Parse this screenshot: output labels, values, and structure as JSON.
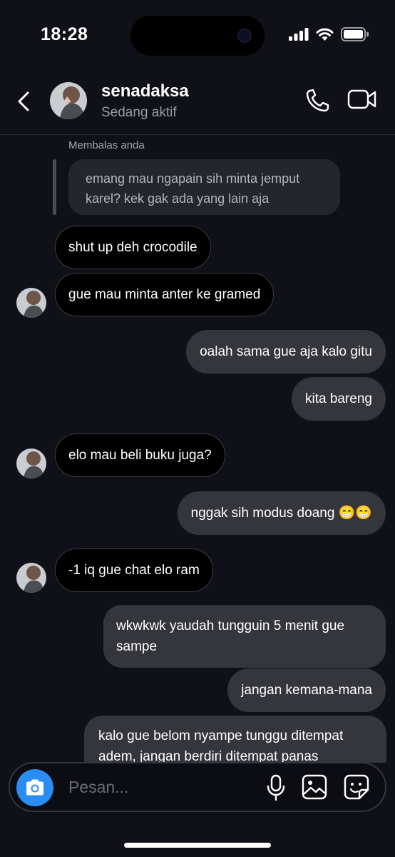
{
  "status": {
    "time": "18:28"
  },
  "header": {
    "name": "senadaksa",
    "subtitle": "Sedang aktif"
  },
  "reply": {
    "label": "Membalas anda",
    "quoted": "emang mau ngapain sih minta jemput karel? kek gak ada yang lain aja"
  },
  "messages": [
    {
      "side": "in",
      "text": "shut up deh crocodile"
    },
    {
      "side": "in",
      "text": "gue mau minta anter ke gramed"
    },
    {
      "side": "out",
      "text": "oalah sama gue aja kalo gitu"
    },
    {
      "side": "out",
      "text": "kita bareng"
    },
    {
      "side": "in",
      "text": "elo mau beli buku juga?"
    },
    {
      "side": "out",
      "text": "nggak sih modus doang 😁😁"
    },
    {
      "side": "in",
      "text": "-1 iq gue chat elo ram"
    },
    {
      "side": "out",
      "text": "wkwkwk yaudah tungguin 5 menit gue sampe"
    },
    {
      "side": "out",
      "text": "jangan kemana-mana"
    },
    {
      "side": "out",
      "text": "kalo gue belom nyampe tunggu ditempat adem, jangan berdiri ditempat panas"
    }
  ],
  "composer": {
    "placeholder": "Pesan..."
  },
  "icons": {
    "back": "chevron-left-icon",
    "call": "phone-icon",
    "video": "video-camera-icon",
    "camera": "camera-icon",
    "mic": "microphone-icon",
    "gallery": "image-icon",
    "sticker": "sticker-icon"
  },
  "colors": {
    "accent": "#2a8df5",
    "background": "#101118",
    "outgoing_bubble": "#35363b",
    "incoming_bubble": "#000000"
  }
}
